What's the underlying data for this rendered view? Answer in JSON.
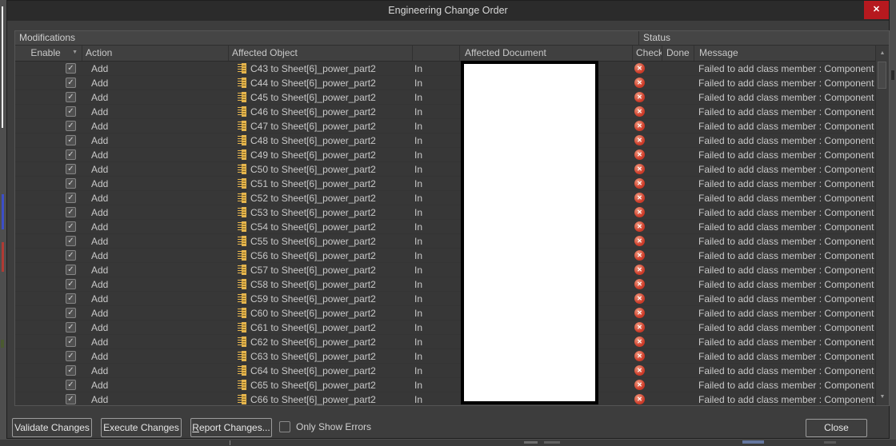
{
  "window": {
    "title": "Engineering Change Order"
  },
  "icons": {
    "close": "✕",
    "dropdown": "▼",
    "scroll_up": "▲",
    "scroll_down": "▼",
    "checkmark": "✓",
    "error_cross": "✕"
  },
  "colors": {
    "close_button": "#b6191f",
    "error_icon": "#cd3a28",
    "component_icon_body": "#e5b54e",
    "component_icon_detail": "#8a6a20",
    "white_overlay": "#ffffff"
  },
  "grid": {
    "group_modifications": "Modifications",
    "group_status": "Status",
    "columns": {
      "enable": "Enable",
      "action": "Action",
      "affected_object": "Affected Object",
      "affected_document": "Affected Document",
      "check": "Check",
      "done": "Done",
      "message": "Message"
    },
    "rows": [
      {
        "enabled": true,
        "action": "Add",
        "object": "C43 to Sheet[6]_power_part2",
        "scope": "In",
        "check": "error",
        "done": "",
        "message": "Failed to add class member : Component"
      },
      {
        "enabled": true,
        "action": "Add",
        "object": "C44 to Sheet[6]_power_part2",
        "scope": "In",
        "check": "error",
        "done": "",
        "message": "Failed to add class member : Component"
      },
      {
        "enabled": true,
        "action": "Add",
        "object": "C45 to Sheet[6]_power_part2",
        "scope": "In",
        "check": "error",
        "done": "",
        "message": "Failed to add class member : Component"
      },
      {
        "enabled": true,
        "action": "Add",
        "object": "C46 to Sheet[6]_power_part2",
        "scope": "In",
        "check": "error",
        "done": "",
        "message": "Failed to add class member : Component"
      },
      {
        "enabled": true,
        "action": "Add",
        "object": "C47 to Sheet[6]_power_part2",
        "scope": "In",
        "check": "error",
        "done": "",
        "message": "Failed to add class member : Component"
      },
      {
        "enabled": true,
        "action": "Add",
        "object": "C48 to Sheet[6]_power_part2",
        "scope": "In",
        "check": "error",
        "done": "",
        "message": "Failed to add class member : Component"
      },
      {
        "enabled": true,
        "action": "Add",
        "object": "C49 to Sheet[6]_power_part2",
        "scope": "In",
        "check": "error",
        "done": "",
        "message": "Failed to add class member : Component"
      },
      {
        "enabled": true,
        "action": "Add",
        "object": "C50 to Sheet[6]_power_part2",
        "scope": "In",
        "check": "error",
        "done": "",
        "message": "Failed to add class member : Component"
      },
      {
        "enabled": true,
        "action": "Add",
        "object": "C51 to Sheet[6]_power_part2",
        "scope": "In",
        "check": "error",
        "done": "",
        "message": "Failed to add class member : Component"
      },
      {
        "enabled": true,
        "action": "Add",
        "object": "C52 to Sheet[6]_power_part2",
        "scope": "In",
        "check": "error",
        "done": "",
        "message": "Failed to add class member : Component"
      },
      {
        "enabled": true,
        "action": "Add",
        "object": "C53 to Sheet[6]_power_part2",
        "scope": "In",
        "check": "error",
        "done": "",
        "message": "Failed to add class member : Component"
      },
      {
        "enabled": true,
        "action": "Add",
        "object": "C54 to Sheet[6]_power_part2",
        "scope": "In",
        "check": "error",
        "done": "",
        "message": "Failed to add class member : Component"
      },
      {
        "enabled": true,
        "action": "Add",
        "object": "C55 to Sheet[6]_power_part2",
        "scope": "In",
        "check": "error",
        "done": "",
        "message": "Failed to add class member : Component"
      },
      {
        "enabled": true,
        "action": "Add",
        "object": "C56 to Sheet[6]_power_part2",
        "scope": "In",
        "check": "error",
        "done": "",
        "message": "Failed to add class member : Component"
      },
      {
        "enabled": true,
        "action": "Add",
        "object": "C57 to Sheet[6]_power_part2",
        "scope": "In",
        "check": "error",
        "done": "",
        "message": "Failed to add class member : Component"
      },
      {
        "enabled": true,
        "action": "Add",
        "object": "C58 to Sheet[6]_power_part2",
        "scope": "In",
        "check": "error",
        "done": "",
        "message": "Failed to add class member : Component"
      },
      {
        "enabled": true,
        "action": "Add",
        "object": "C59 to Sheet[6]_power_part2",
        "scope": "In",
        "check": "error",
        "done": "",
        "message": "Failed to add class member : Component"
      },
      {
        "enabled": true,
        "action": "Add",
        "object": "C60 to Sheet[6]_power_part2",
        "scope": "In",
        "check": "error",
        "done": "",
        "message": "Failed to add class member : Component"
      },
      {
        "enabled": true,
        "action": "Add",
        "object": "C61 to Sheet[6]_power_part2",
        "scope": "In",
        "check": "error",
        "done": "",
        "message": "Failed to add class member : Component"
      },
      {
        "enabled": true,
        "action": "Add",
        "object": "C62 to Sheet[6]_power_part2",
        "scope": "In",
        "check": "error",
        "done": "",
        "message": "Failed to add class member : Component"
      },
      {
        "enabled": true,
        "action": "Add",
        "object": "C63 to Sheet[6]_power_part2",
        "scope": "In",
        "check": "error",
        "done": "",
        "message": "Failed to add class member : Component"
      },
      {
        "enabled": true,
        "action": "Add",
        "object": "C64 to Sheet[6]_power_part2",
        "scope": "In",
        "check": "error",
        "done": "",
        "message": "Failed to add class member : Component"
      },
      {
        "enabled": true,
        "action": "Add",
        "object": "C65 to Sheet[6]_power_part2",
        "scope": "In",
        "check": "error",
        "done": "",
        "message": "Failed to add class member : Component"
      },
      {
        "enabled": true,
        "action": "Add",
        "object": "C66 to Sheet[6]_power_part2",
        "scope": "In",
        "check": "error",
        "done": "",
        "message": "Failed to add class member : Component"
      }
    ]
  },
  "footer": {
    "validate": "Validate Changes",
    "execute": "Execute Changes",
    "report": "Report Changes...",
    "report_accel_first": "R",
    "report_accel_rest": "eport Changes...",
    "only_show_errors": "Only Show Errors",
    "close": "Close"
  }
}
